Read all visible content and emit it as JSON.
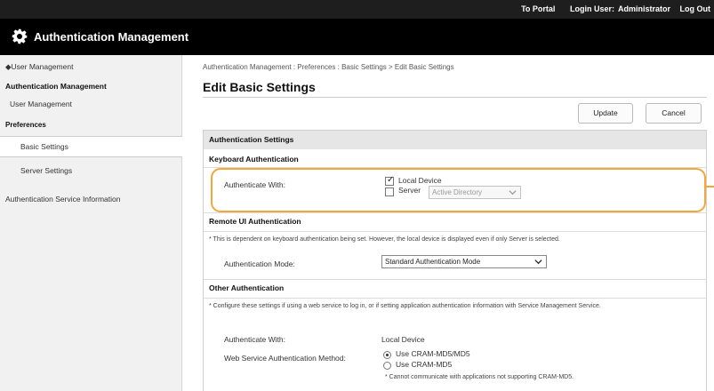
{
  "topbar": {
    "portal": "To Portal",
    "login_user": "Login User:",
    "user_name": "Administrator",
    "logout": "Log Out"
  },
  "header": {
    "title": "Authentication Management"
  },
  "sidebar": {
    "back": "◆User Management",
    "section": "Authentication Management",
    "user_management": "User Management",
    "preferences": "Preferences",
    "basic_settings": "Basic Settings",
    "server_settings": "Server Settings",
    "service_info": "Authentication Service Information"
  },
  "main": {
    "breadcrumb": "Authentication Management : Preferences : Basic Settings > Edit Basic Settings",
    "title": "Edit Basic Settings",
    "update_button": "Update",
    "cancel_button": "Cancel"
  },
  "auth_settings": {
    "heading": "Authentication Settings",
    "keyboard": {
      "heading": "Keyboard Authentication",
      "label": "Authenticate With:",
      "local_device": "Local Device",
      "local_device_checked": true,
      "server": "Server",
      "server_checked": false,
      "server_select": "Active Directory"
    },
    "remote": {
      "heading": "Remote UI Authentication",
      "note": "* This is dependent on keyboard authentication being set. However, the local device is displayed even if only Server is selected.",
      "mode_label": "Authentication Mode:",
      "mode_value": "Standard Authentication Mode"
    },
    "other": {
      "heading": "Other Authentication",
      "note": "* Configure these settings if using a web service to log in, or if setting application authentication information with Service Management Service.",
      "auth_with_label": "Authenticate With:",
      "auth_with_value": "Local Device",
      "web_service_label": "Web Service Authentication Method:",
      "option1": "Use CRAM-MD5/MD5",
      "option2": "Use CRAM-MD5",
      "option_note": "* Cannot communicate with applications not supporting CRAM-MD5."
    }
  },
  "colors": {
    "highlight": "#f1a73a",
    "titlebar": "#000000"
  }
}
